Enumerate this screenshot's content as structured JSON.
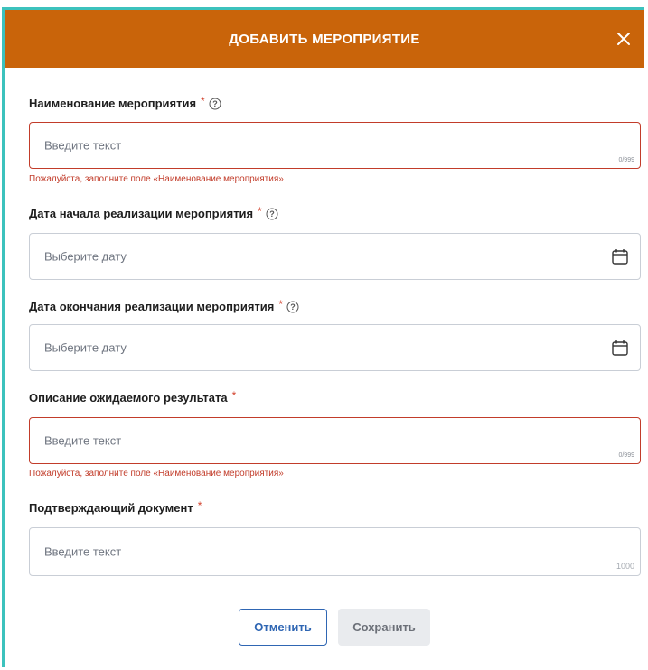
{
  "dialog": {
    "title": "ДОБАВИТЬ МЕРОПРИЯТИЕ",
    "required_mark": "*"
  },
  "fields": {
    "name": {
      "label": "Наименование мероприятия",
      "placeholder": "Введите текст",
      "counter": "0/999",
      "error": "Пожалуйста, заполните поле «Наименование мероприятия»"
    },
    "start_date": {
      "label": "Дата начала реализации мероприятия",
      "placeholder": "Выберите дату"
    },
    "end_date": {
      "label": "Дата окончания реализации мероприятия",
      "placeholder": "Выберите дату"
    },
    "expected_result": {
      "label": "Описание ожидаемого результата",
      "placeholder": "Введите текст",
      "counter": "0/999",
      "error": "Пожалуйста, заполните поле «Наименование мероприятия»"
    },
    "document": {
      "label": "Подтверждающий документ",
      "placeholder": "Введите текст",
      "counter": "1000"
    }
  },
  "buttons": {
    "cancel": "Отменить",
    "save": "Сохранить"
  },
  "colors": {
    "header": "#c9640a",
    "error": "#c23c2a",
    "primary": "#2f66b3",
    "frame_accent": "#3cc2bd"
  },
  "icons": {
    "close": "close-icon",
    "help": "help-icon",
    "calendar": "calendar-icon"
  }
}
